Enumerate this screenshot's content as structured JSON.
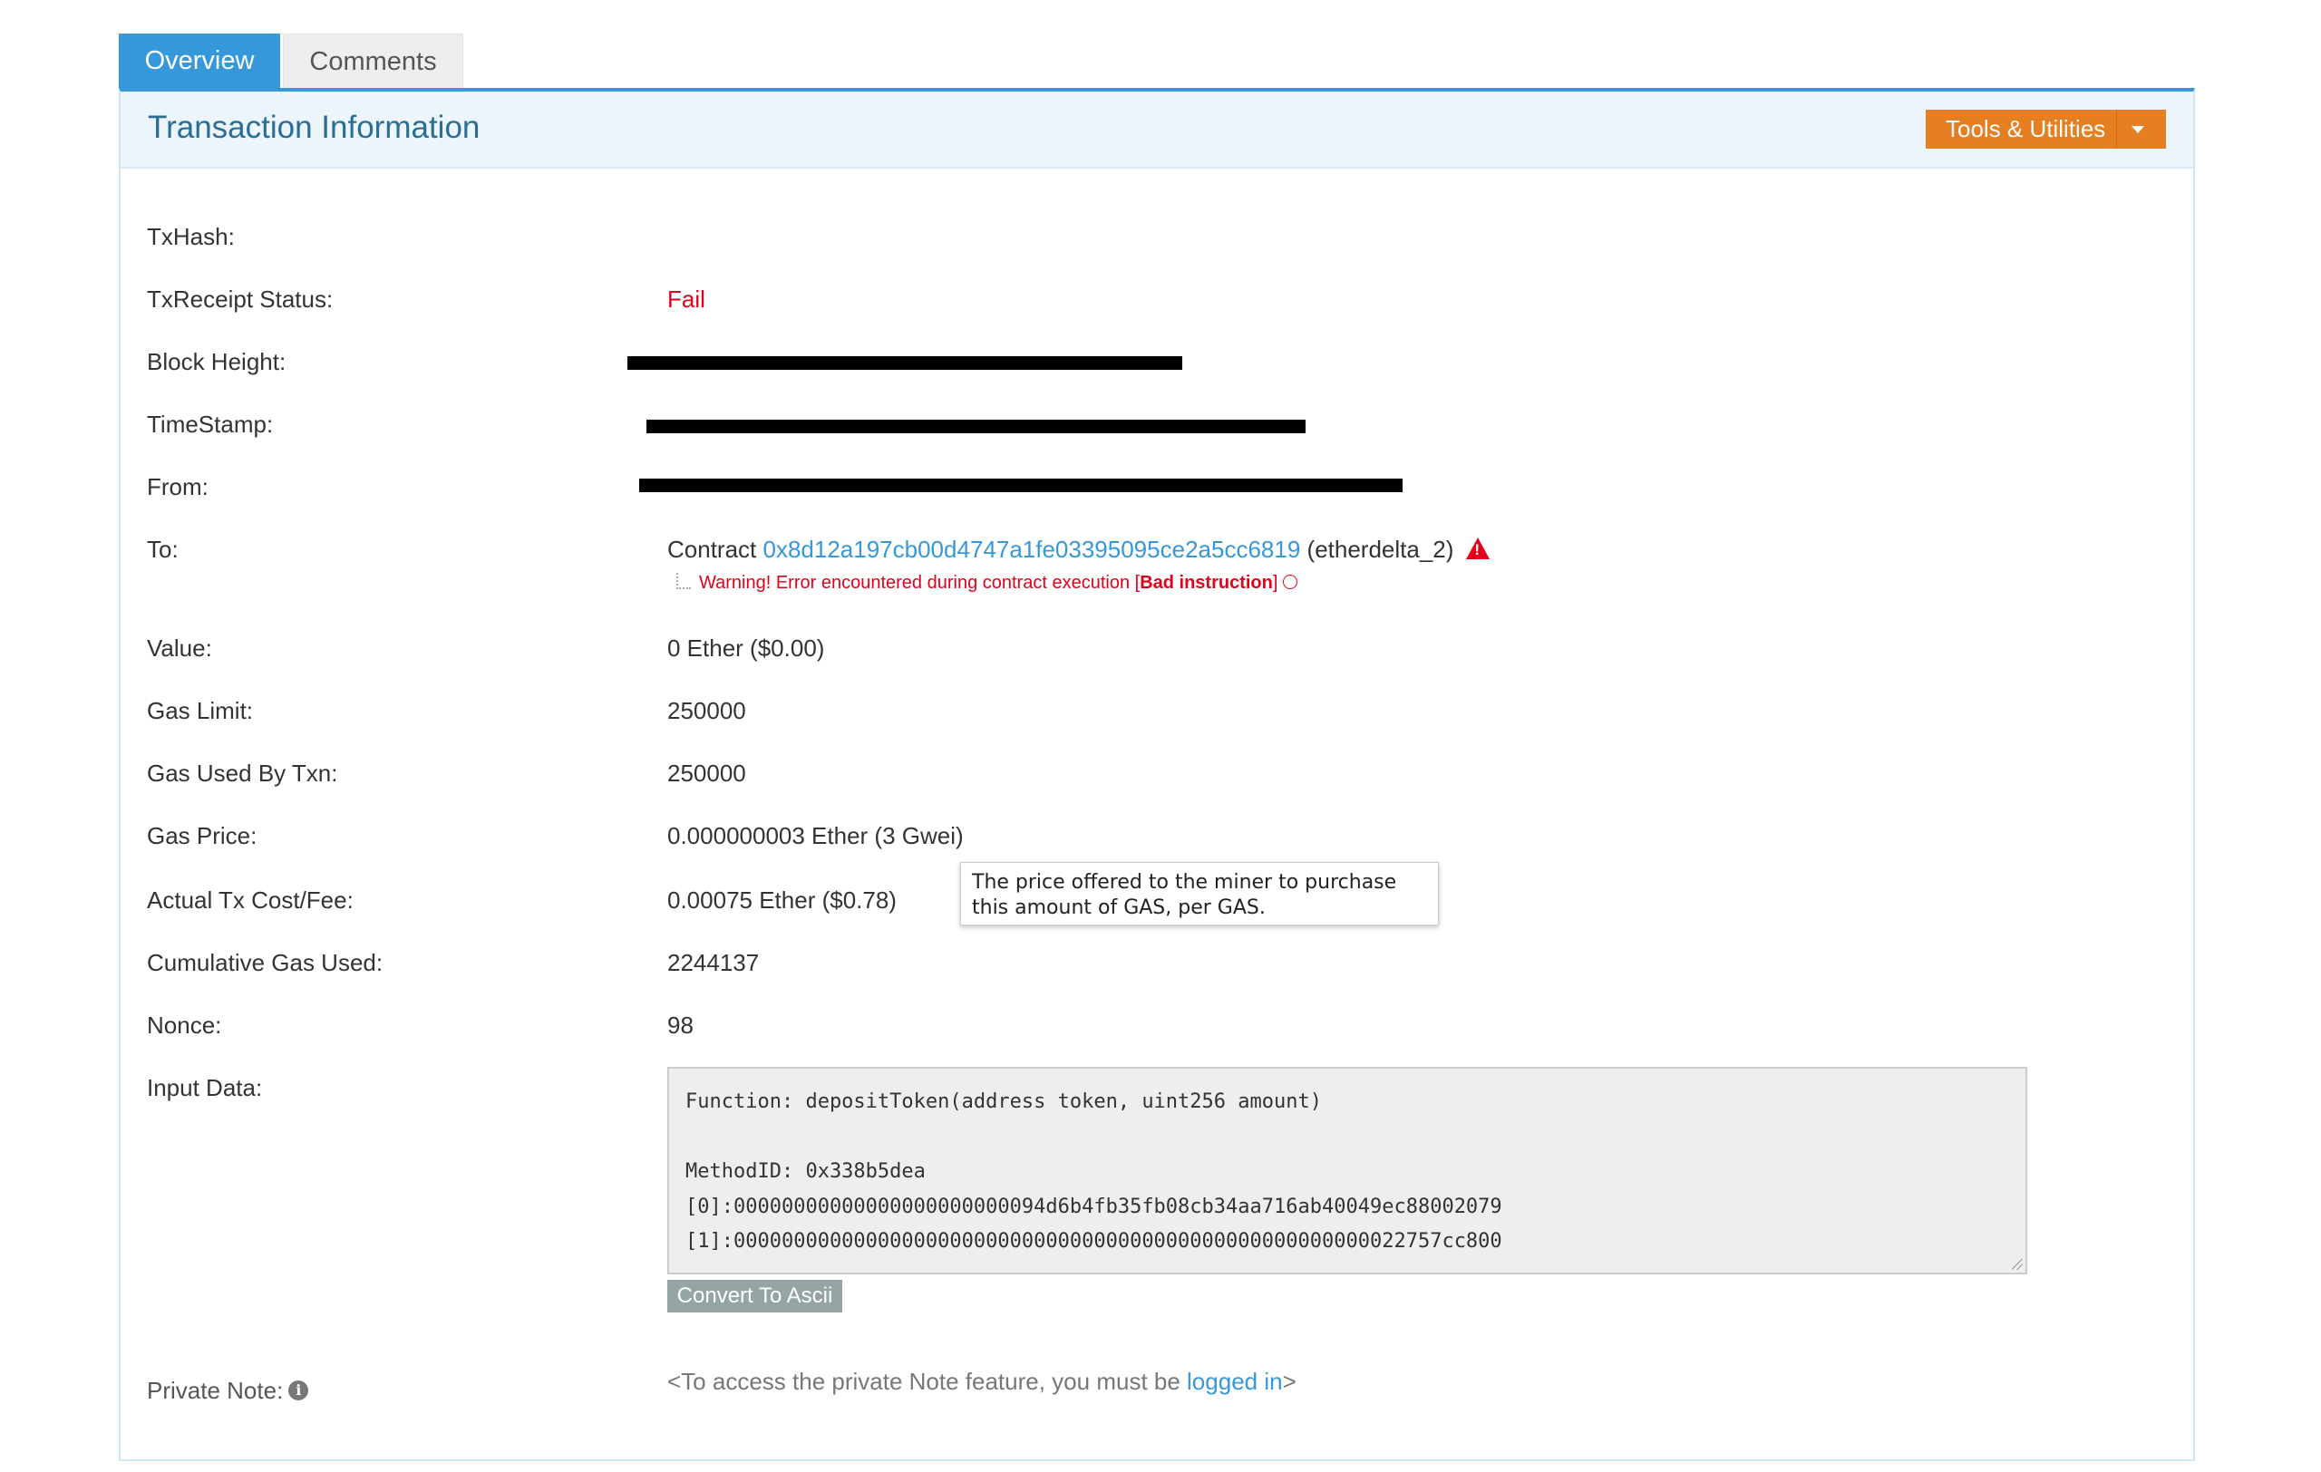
{
  "tabs": {
    "overview": "Overview",
    "comments": "Comments"
  },
  "panel": {
    "title": "Transaction Information",
    "tools_label": "Tools & Utilities"
  },
  "labels": {
    "txhash": "TxHash:",
    "receipt_status": "TxReceipt Status:",
    "block_height": "Block Height:",
    "timestamp": "TimeStamp:",
    "from": "From:",
    "to": "To:",
    "value": "Value:",
    "gas_limit": "Gas Limit:",
    "gas_used": "Gas Used By Txn:",
    "gas_price": "Gas Price:",
    "actual_fee": "Actual Tx Cost/Fee:",
    "cumulative_gas": "Cumulative Gas Used:",
    "nonce": "Nonce:",
    "input_data": "Input Data:",
    "private_note": "Private Note:"
  },
  "values": {
    "receipt_status": "Fail",
    "to_prefix": "Contract",
    "to_address": "0x8d12a197cb00d4747a1fe03395095ce2a5cc6819",
    "to_name": "(etherdelta_2)",
    "warning_prefix": "Warning! Error encountered during contract execution [",
    "warning_bold": "Bad instruction",
    "warning_suffix": "]",
    "value": "0 Ether ($0.00)",
    "gas_limit": "250000",
    "gas_used": "250000",
    "gas_price": "0.000000003 Ether (3 Gwei)",
    "actual_fee": "0.00075 Ether ($0.78)",
    "cumulative_gas": "2244137",
    "nonce": "98"
  },
  "tooltip": {
    "text": "The price offered to the miner to purchase this amount of GAS, per GAS."
  },
  "input_data": {
    "function": "Function: depositToken(address token, uint256 amount)",
    "method_id": "MethodID: 0x338b5dea",
    "arg0": "[0]:00000000000000000000000094d6b4fb35fb08cb34aa716ab40049ec88002079",
    "arg1": "[1]:00000000000000000000000000000000000000000000000000000022757cc800",
    "convert_label": "Convert To Ascii"
  },
  "private_note": {
    "prefix": "<To access the private Note feature, you must be ",
    "link": "logged in",
    "suffix": ">"
  },
  "colors": {
    "accent": "#3498db",
    "tools": "#e67e22",
    "error": "#e3001b",
    "button_gray": "#95a5a6"
  },
  "icons": {
    "tools_caret": "chevron-down-icon",
    "warning": "warning-triangle-icon",
    "frown": "frown-icon",
    "info": "info-icon"
  }
}
